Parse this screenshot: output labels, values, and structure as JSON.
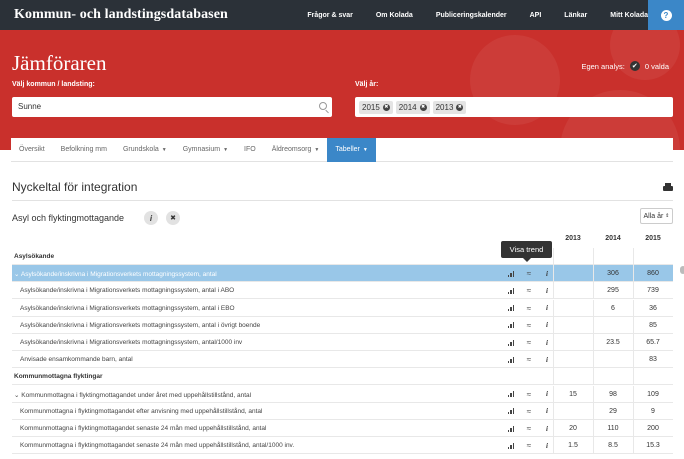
{
  "topbar": {
    "brand": "Kommun- och landstingsdatabasen",
    "nav": [
      "Frågor & svar",
      "Om Kolada",
      "Publiceringskalender",
      "API",
      "Länkar",
      "Mitt Kolada"
    ],
    "help_icon": "question-circle-icon"
  },
  "hero": {
    "title": "Jämföraren",
    "egen_label": "Egen analys:",
    "egen_value": "0 valda",
    "kommun_label": "Välj kommun / landsting:",
    "kommun_value": "Sunne",
    "year_label": "Välj år:",
    "years": [
      "2015",
      "2014",
      "2013"
    ]
  },
  "tabs": [
    {
      "label": "Översikt",
      "dropdown": false
    },
    {
      "label": "Befolkning mm",
      "dropdown": false
    },
    {
      "label": "Grundskola",
      "dropdown": true
    },
    {
      "label": "Gymnasium",
      "dropdown": true
    },
    {
      "label": "IFO",
      "dropdown": false
    },
    {
      "label": "Äldreomsorg",
      "dropdown": true
    },
    {
      "label": "Tabeller",
      "dropdown": true,
      "active": true
    }
  ],
  "content": {
    "heading": "Nyckeltal för integration",
    "subheading": "Asyl och flyktingmottagande",
    "info_icon": "i",
    "close_icon": "✖",
    "filter": "Alla år",
    "tooltip": "Visa trend",
    "year_headers": [
      "2013",
      "2014",
      "2015"
    ]
  },
  "table": {
    "rows": [
      {
        "type": "group",
        "name": "Asylsökande",
        "values": [
          "",
          "",
          ""
        ]
      },
      {
        "type": "main",
        "selected": true,
        "name": "Asylsökande/inskrivna i Migrationsverkets mottagningssystem, antal",
        "values": [
          "",
          "306",
          "860"
        ]
      },
      {
        "type": "sub",
        "name": "Asylsökande/inskrivna i Migrationsverkets mottagningssystem, antal i ABO",
        "values": [
          "",
          "295",
          "739"
        ]
      },
      {
        "type": "sub",
        "name": "Asylsökande/inskrivna i Migrationsverkets mottagningssystem, antal i EBO",
        "values": [
          "",
          "6",
          "36"
        ]
      },
      {
        "type": "sub",
        "name": "Asylsökande/inskrivna i Migrationsverkets mottagningssystem, antal i övrigt boende",
        "values": [
          "",
          "",
          "85"
        ]
      },
      {
        "type": "sub",
        "name": "Asylsökande/inskrivna i Migrationsverkets mottagningssystem, antal/1000 inv",
        "values": [
          "",
          "23.5",
          "65.7"
        ]
      },
      {
        "type": "sub",
        "name": "Anvisade ensamkommande barn, antal",
        "values": [
          "",
          "",
          "83"
        ]
      },
      {
        "type": "group",
        "name": "Kommunmottagna flyktingar",
        "values": [
          "",
          "",
          ""
        ]
      },
      {
        "type": "main",
        "selected": false,
        "name": "Kommunmottagna i flyktingmottagandet under året med uppehållstillstånd, antal",
        "values": [
          "15",
          "98",
          "109"
        ]
      },
      {
        "type": "sub",
        "name": "Kommunmottagna i flyktingmottagandet efter anvisning med uppehållstillstånd, antal",
        "values": [
          "",
          "29",
          "9"
        ]
      },
      {
        "type": "sub",
        "name": "Kommunmottagna i flyktingmottagandet senaste 24 mån med uppehållstillstånd, antal",
        "values": [
          "20",
          "110",
          "200"
        ]
      },
      {
        "type": "sub",
        "name": "Kommunmottagna i flyktingmottagandet senaste 24 mån med uppehållstillstånd, antal/1000 inv.",
        "values": [
          "1.5",
          "8.5",
          "15.3"
        ]
      }
    ]
  }
}
